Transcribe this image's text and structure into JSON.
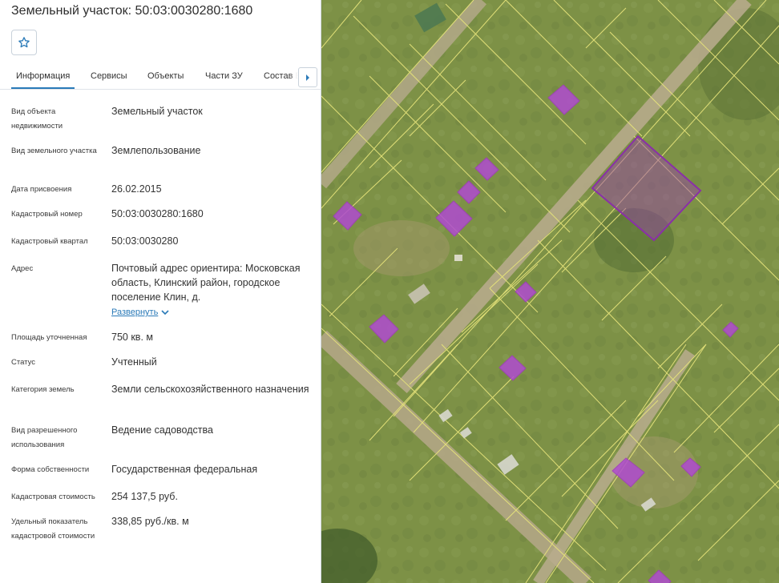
{
  "header": {
    "title": "Земельный участок: 50:03:0030280:1680"
  },
  "favorite": {
    "icon": "star-icon"
  },
  "tabs": [
    {
      "label": "Информация",
      "active": true
    },
    {
      "label": "Сервисы",
      "active": false
    },
    {
      "label": "Объекты",
      "active": false
    },
    {
      "label": "Части ЗУ",
      "active": false
    },
    {
      "label": "Состав ЕЗП",
      "active": false
    }
  ],
  "fields": [
    {
      "label": "Вид объекта недвижимости",
      "value": "Земельный участок"
    },
    {
      "label": "Вид земельного участка",
      "value": "Землепользование"
    },
    {
      "label": "Дата присвоения",
      "value": "26.02.2015"
    },
    {
      "label": "Кадастровый номер",
      "value": "50:03:0030280:1680"
    },
    {
      "label": "Кадастровый квартал",
      "value": "50:03:0030280"
    },
    {
      "label": "Адрес",
      "value": "Почтовый адрес ориентира: Московская область, Клинский район, городское поселение Клин, д."
    },
    {
      "label": "Площадь уточненная",
      "value": "750 кв. м"
    },
    {
      "label": "Статус",
      "value": "Учтенный"
    },
    {
      "label": "Категория земель",
      "value": "Земли сельскохозяйственного назначения"
    },
    {
      "label": "Вид разрешенного использования",
      "value": "Ведение садоводства"
    },
    {
      "label": "Форма собственности",
      "value": "Государственная федеральная"
    },
    {
      "label": "Кадастровая стоимость",
      "value": "254 137,5 руб."
    },
    {
      "label": "Удельный показатель кадастровой стоимости",
      "value": "338,85 руб./кв. м"
    }
  ],
  "address_expand": {
    "label": "Развернуть",
    "icon": "chevron-down-icon"
  },
  "colors": {
    "accent": "#2a7ab8",
    "parcel_border": "#e6e37a",
    "building_fill": "#b04bd0",
    "selected_parcel": "#8a2fa8",
    "grass": "#7d9146"
  }
}
